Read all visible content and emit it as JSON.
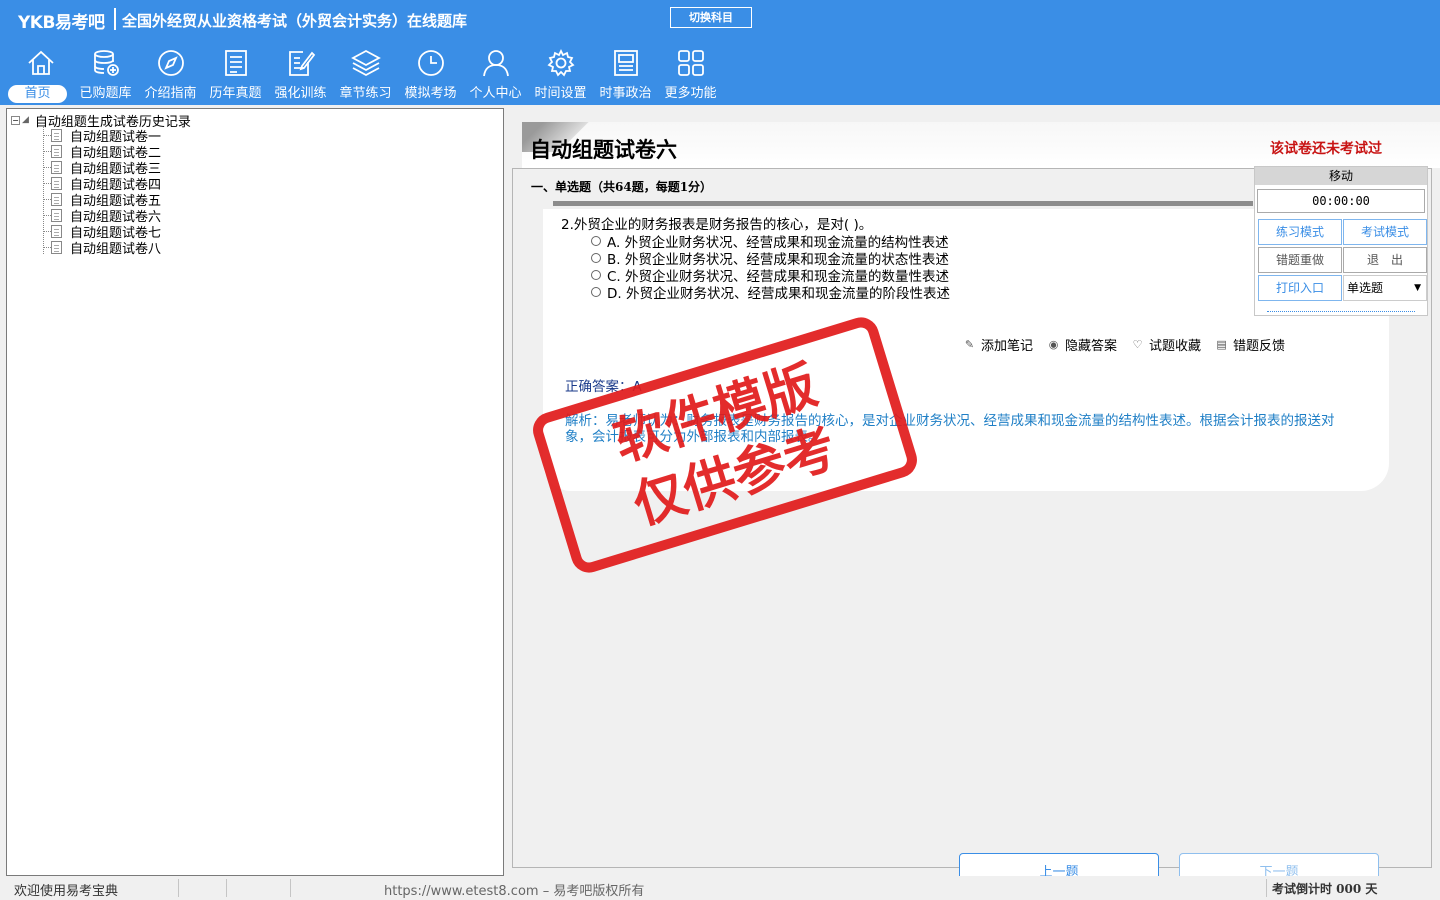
{
  "header": {
    "logo": "YKB易考吧",
    "title": "全国外经贸从业资格考试（外贸会计实务）在线题库",
    "switch_subject": "切换科目",
    "nav": [
      {
        "label": "首页",
        "icon": "home-icon"
      },
      {
        "label": "已购题库",
        "icon": "database-icon"
      },
      {
        "label": "介绍指南",
        "icon": "compass-icon"
      },
      {
        "label": "历年真题",
        "icon": "document-list-icon"
      },
      {
        "label": "强化训练",
        "icon": "edit-icon"
      },
      {
        "label": "章节练习",
        "icon": "layers-icon"
      },
      {
        "label": "模拟考场",
        "icon": "clock-icon"
      },
      {
        "label": "个人中心",
        "icon": "user-icon"
      },
      {
        "label": "时间设置",
        "icon": "gear-icon"
      },
      {
        "label": "时事政治",
        "icon": "newspaper-icon"
      },
      {
        "label": "更多功能",
        "icon": "grid-icon"
      }
    ]
  },
  "tree": {
    "root": "自动组题生成试卷历史记录",
    "items": [
      "自动组题试卷一",
      "自动组题试卷二",
      "自动组题试卷三",
      "自动组题试卷四",
      "自动组题试卷五",
      "自动组题试卷六",
      "自动组题试卷七",
      "自动组题试卷八"
    ]
  },
  "paper": {
    "title": "自动组题试卷六",
    "status": "该试卷还未考试过",
    "section": "一、单选题（共64题，每题1分）"
  },
  "question": {
    "stem": "2.外贸企业的财务报表是财务报告的核心，是对( )。",
    "options": [
      "A. 外贸企业财务状况、经营成果和现金流量的结构性表述",
      "B. 外贸企业财务状况、经营成果和现金流量的状态性表述",
      "C. 外贸企业财务状况、经营成果和现金流量的数量性表述",
      "D. 外贸企业财务状况、经营成果和现金流量的阶段性表述"
    ],
    "tools": {
      "add_note": "添加笔记",
      "hide_answer": "隐藏答案",
      "favorite": "试题收藏",
      "feedback": "错题反馈"
    },
    "answer": "正确答案：A",
    "analysis": "解析：易老师认为：财务报表是财务报告的核心，是对企业财务状况、经营成果和现金流量的结构性表述。根据会计报表的报送对象，会计报表可分为外部报表和内部报表。"
  },
  "navigation": {
    "prev": "上一题",
    "next": "下一题"
  },
  "control": {
    "move": "移动",
    "timer": "00:00:00",
    "practice_mode": "练习模式",
    "exam_mode": "考试模式",
    "redo_wrong": "错题重做",
    "exit": "退　出",
    "print": "打印入口",
    "question_type": "单选题"
  },
  "watermark": {
    "line1": "软件模版",
    "line2": "仅供参考"
  },
  "status": {
    "welcome": "欢迎使用易考宝典",
    "url": "https://www.etest8.com – 易考吧版权所有",
    "countdown": "考试倒计时 000 天"
  },
  "colors": {
    "header": "#3a8ee6",
    "stamp": "#e11b1b",
    "status_red": "#c81414"
  }
}
